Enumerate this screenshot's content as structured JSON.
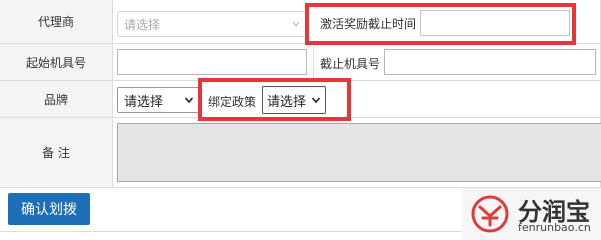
{
  "form": {
    "agent": {
      "label": "代理商",
      "placeholder": "请选择"
    },
    "reward_deadline": {
      "label": "激活奖励截止时间",
      "value": ""
    },
    "start_sn": {
      "label": "起始机具号",
      "value": ""
    },
    "end_sn": {
      "label": "截止机具号",
      "value": ""
    },
    "brand": {
      "label": "品牌",
      "selected": "请选择"
    },
    "policy": {
      "label": "绑定政策",
      "selected": "请选择"
    },
    "remark": {
      "label": "备 注",
      "value": ""
    },
    "submit_label": "确认划拨"
  },
  "watermark": {
    "brand": "分润宝",
    "url": "fenrunbao.cn"
  },
  "colors": {
    "highlight": "#e8343b",
    "primary_button": "#1d6fb8",
    "logo_red": "#e23a3a"
  }
}
